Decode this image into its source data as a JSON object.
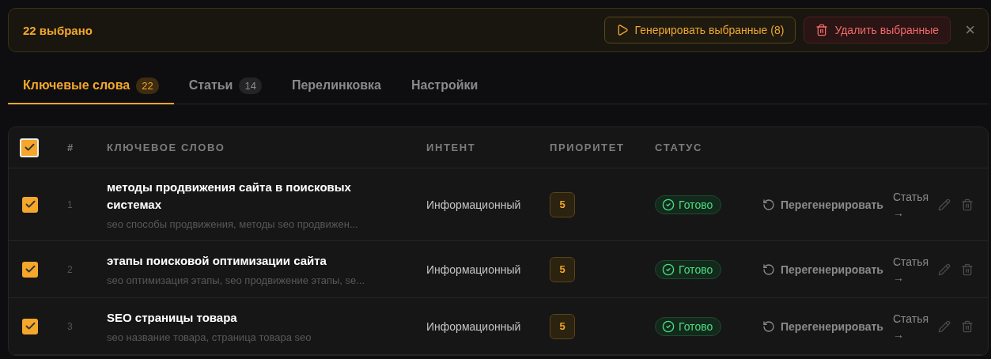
{
  "selection_bar": {
    "count_label": "22 выбрано",
    "generate_button": "Генерировать выбранные (8)",
    "delete_button": "Удалить выбранные",
    "close": "×"
  },
  "tabs": [
    {
      "label": "Ключевые слова",
      "count": "22",
      "selected": true
    },
    {
      "label": "Статьи",
      "count": "14",
      "selected": false
    },
    {
      "label": "Перелинковка",
      "selected": false
    },
    {
      "label": "Настройки",
      "selected": false
    }
  ],
  "table": {
    "all_checked": true,
    "columns": [
      "#",
      "КЛЮЧЕВОЕ СЛОВО",
      "ИНТЕНТ",
      "ПРИОРИТЕТ",
      "СТАТУС"
    ],
    "rows": [
      {
        "checked": true,
        "number": "1",
        "keyword": "методы продвижения сайта в поисковых системах",
        "related": "seo способы продвижения, методы seo продвижен...",
        "intent": "Информационный",
        "priority": "5",
        "status": {
          "kind": "ready",
          "label": "Готово"
        },
        "regenerate": "Перегенерировать",
        "article_link": "Статья →"
      },
      {
        "checked": true,
        "number": "2",
        "keyword": "этапы поисковой оптимизации сайта",
        "related": "seo оптимизация этапы, seo продвижение этапы, se...",
        "intent": "Информационный",
        "priority": "5",
        "status": {
          "kind": "ready",
          "label": "Готово"
        },
        "regenerate": "Перегенерировать",
        "article_link": "Статья →"
      },
      {
        "checked": true,
        "number": "3",
        "keyword": "SEO страницы товара",
        "related": "seo название товара, страница товара seo",
        "intent": "Информационный",
        "priority": "5",
        "status": {
          "kind": "ready",
          "label": "Готово"
        },
        "regenerate": "Перегенерировать",
        "article_link": "Статья →"
      }
    ]
  }
}
